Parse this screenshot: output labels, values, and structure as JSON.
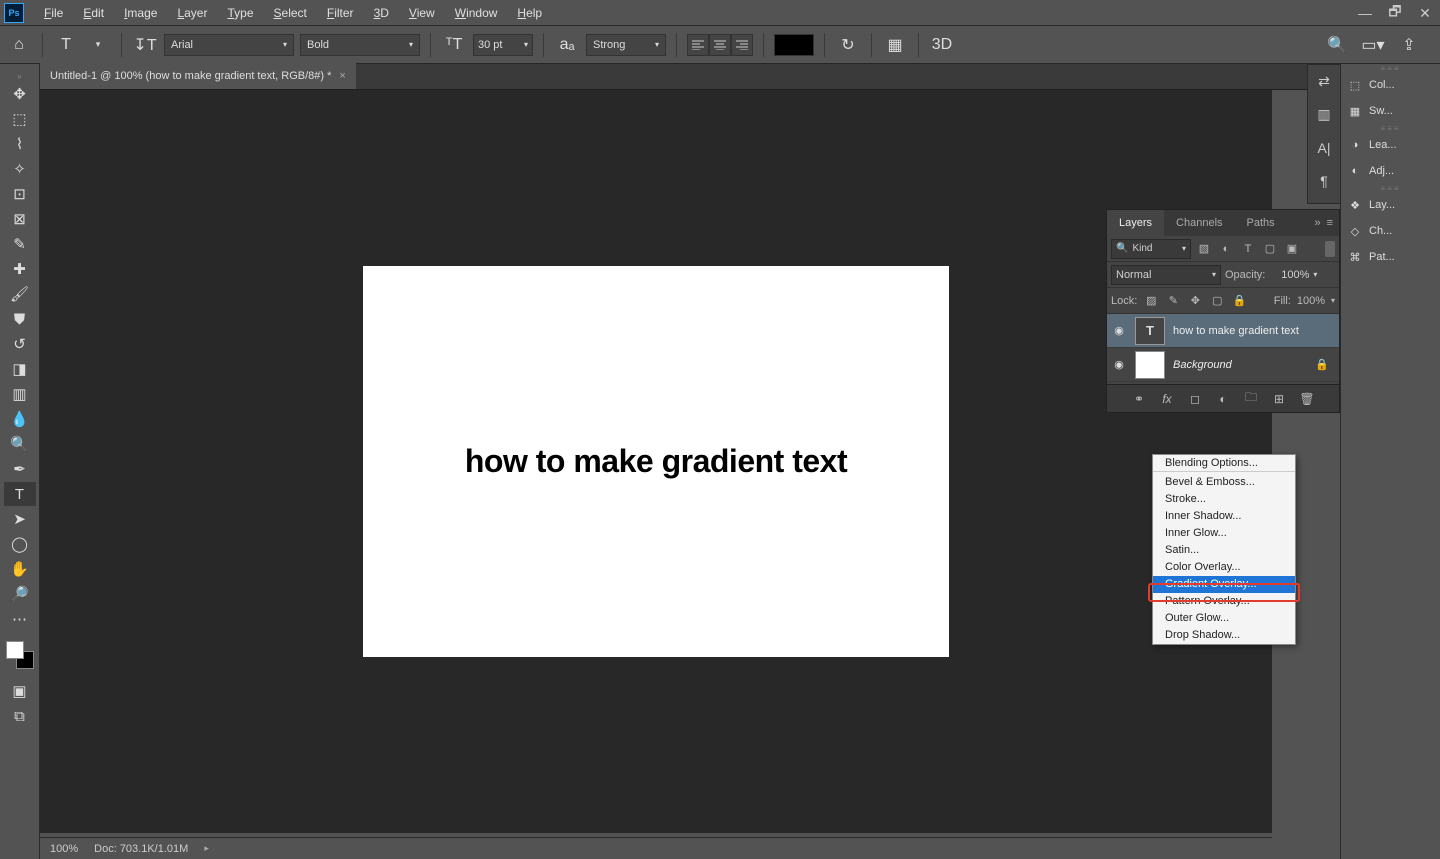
{
  "menubar": {
    "items": [
      "File",
      "Edit",
      "Image",
      "Layer",
      "Type",
      "Select",
      "Filter",
      "3D",
      "View",
      "Window",
      "Help"
    ]
  },
  "options": {
    "font_family": "Arial",
    "font_weight": "Bold",
    "font_size": "30 pt",
    "aa": "Strong",
    "threeD": "3D"
  },
  "tab": {
    "title": "Untitled-1 @ 100% (how to make gradient text, RGB/8#) *"
  },
  "canvas": {
    "text": "how to make gradient text"
  },
  "right_panels": {
    "group1": [
      {
        "icon": "⬚",
        "label": "Col..."
      },
      {
        "icon": "▦",
        "label": "Sw..."
      }
    ],
    "group2": [
      {
        "icon": "◑",
        "label": "Lea..."
      },
      {
        "icon": "◐",
        "label": "Adj..."
      }
    ],
    "group3": [
      {
        "icon": "❖",
        "label": "Lay..."
      },
      {
        "icon": "◇",
        "label": "Ch..."
      },
      {
        "icon": "⌘",
        "label": "Pat..."
      }
    ]
  },
  "layers_panel": {
    "tabs": [
      "Layers",
      "Channels",
      "Paths"
    ],
    "filter_label": "Kind",
    "blend_mode": "Normal",
    "opacity_label": "Opacity:",
    "opacity_value": "100%",
    "lock_label": "Lock:",
    "fill_label": "Fill:",
    "fill_value": "100%",
    "layers": [
      {
        "name": "how to make gradient text",
        "type": "text",
        "selected": true
      },
      {
        "name": "Background",
        "type": "bg",
        "locked": true
      }
    ]
  },
  "fx_menu": {
    "items": [
      "Blending Options...",
      "Bevel & Emboss...",
      "Stroke...",
      "Inner Shadow...",
      "Inner Glow...",
      "Satin...",
      "Color Overlay...",
      "Gradient Overlay...",
      "Pattern Overlay...",
      "Outer Glow...",
      "Drop Shadow..."
    ],
    "selected": "Gradient Overlay..."
  },
  "status": {
    "zoom": "100%",
    "doc": "Doc: 703.1K/1.01M"
  }
}
